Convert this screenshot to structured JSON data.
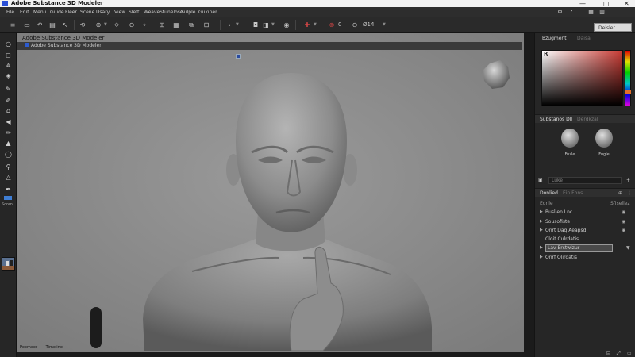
{
  "window": {
    "title": "Adobe Substance 3D Modeler",
    "controls": {
      "minimize": "—",
      "maximize": "□",
      "close": "✕"
    }
  },
  "menu": {
    "items": [
      "File",
      "Edit",
      "Menu",
      "Guide",
      "Fleer",
      "Scene",
      "Usary",
      "View",
      "Sleft",
      "Weave",
      "Stunelose",
      "Sulple",
      "Gukiner"
    ],
    "right_icons": [
      "gear-icon",
      "help-icon",
      "grid-icon",
      "panel-icon"
    ]
  },
  "toolbar": {
    "search_placeholder": "Deisler",
    "zoom_label": "Ø14",
    "record_value": "0"
  },
  "left_tools": {
    "icons": [
      "lasso-icon",
      "select-icon",
      "move-icon",
      "fill-icon",
      "pen-icon",
      "clay-icon",
      "home-icon",
      "arrow-icon",
      "brush-icon",
      "smooth-icon",
      "inflate-icon",
      "flatten-icon",
      "knife-icon",
      "eyedrop-icon"
    ],
    "swatch_color": "#3f7ed4",
    "label": "Scom"
  },
  "viewport": {
    "header": "Adobe Substance 3D Modeler",
    "subheader": "Adobe Substance 3D Modeler",
    "footer": [
      "Peomeer",
      "Timeline"
    ]
  },
  "right_panel": {
    "tabs": [
      "Bzugment",
      "Daisa"
    ],
    "picker_label": "R",
    "picker_base_color": "#c93b34",
    "swatch_color": "#e36e2a",
    "materials_section": {
      "label": "Substanos Dll",
      "inactive": "Derdkzal"
    },
    "materials": [
      {
        "label": "Fuzle"
      },
      {
        "label": "Fugle"
      }
    ],
    "search_label": "Luke",
    "layers_section": {
      "label": "Donlied",
      "inactive": "Ein Fbns"
    },
    "layers_subheader": {
      "left": "Eonle",
      "right": "Sfisellez"
    },
    "layers": [
      {
        "label": "Buslien Lnc",
        "expanded": true
      },
      {
        "label": "Sousofiste",
        "expanded": true
      },
      {
        "label": "Onrt Daq Aeapsd",
        "expanded": true
      },
      {
        "label": "Cloit Culrdatis",
        "expanded": false
      },
      {
        "label": "Lav Erstwizur",
        "expanded": true,
        "selected": true
      },
      {
        "label": "Onrf Olirdatis",
        "expanded": true
      }
    ]
  }
}
